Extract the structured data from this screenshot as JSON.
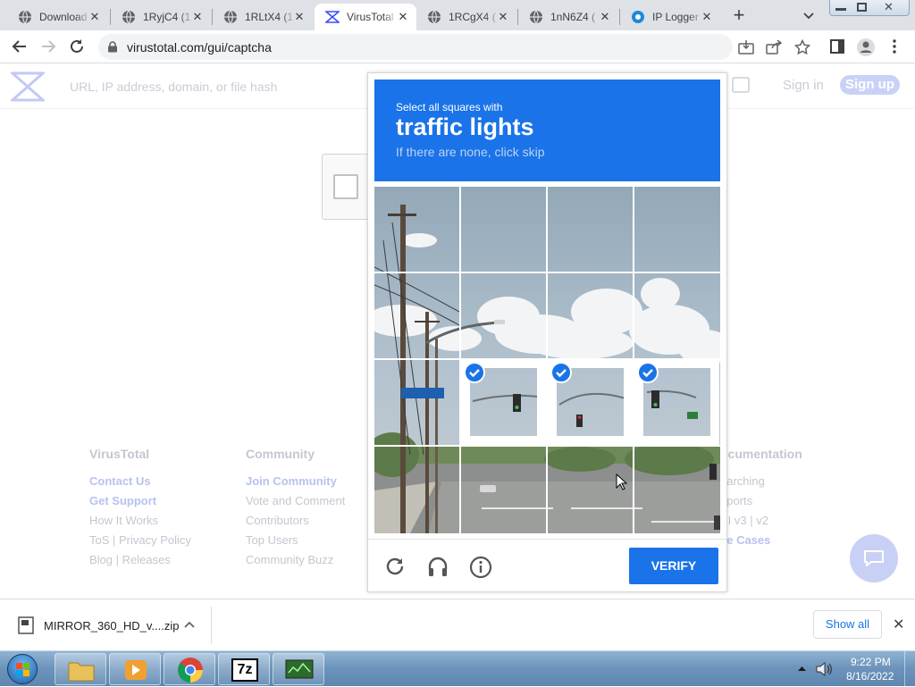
{
  "browser": {
    "tabs": [
      {
        "title": "Download",
        "active": false
      },
      {
        "title": "1RyjC4 (1",
        "active": false
      },
      {
        "title": "1RLtX4 (1",
        "active": false
      },
      {
        "title": "VirusTotal",
        "active": true
      },
      {
        "title": "1RCgX4 (",
        "active": false
      },
      {
        "title": "1nN6Z4 (",
        "active": false
      },
      {
        "title": "IP Logger",
        "active": false
      }
    ],
    "new_tab": "+",
    "url": "virustotal.com/gui/captcha"
  },
  "virustotal": {
    "search_placeholder": "URL, IP address, domain, or file hash",
    "sign_in": "Sign in",
    "sign_up": "Sign up",
    "footer": {
      "columns": [
        {
          "heading": "VirusTotal",
          "links": [
            "Contact Us",
            "Get Support",
            "How It Works",
            "ToS | Privacy Policy",
            "Blog | Releases"
          ]
        },
        {
          "heading": "Community",
          "links": [
            "Join Community",
            "Vote and Comment",
            "Contributors",
            "Top Users",
            "Community Buzz"
          ]
        },
        {
          "heading": "ocumentation",
          "links": [
            "earching",
            "eports",
            "PI v3 | v2",
            "se Cases"
          ]
        }
      ]
    }
  },
  "captcha": {
    "instruction": "Select all squares with",
    "target": "traffic lights",
    "hint": "If there are none, click skip",
    "selected_cells": [
      9,
      10,
      11
    ],
    "verify_label": "VERIFY",
    "accent_color": "#1a73e8",
    "icons": [
      "reload-icon",
      "audio-icon",
      "info-icon"
    ]
  },
  "download_bar": {
    "filename": "MIRROR_360_HD_v....zip",
    "show_all": "Show all"
  },
  "taskbar": {
    "time": "9:22 PM",
    "date": "8/16/2022",
    "apps": [
      "file-explorer",
      "media-player",
      "chrome",
      "7zip",
      "network-monitor"
    ]
  }
}
